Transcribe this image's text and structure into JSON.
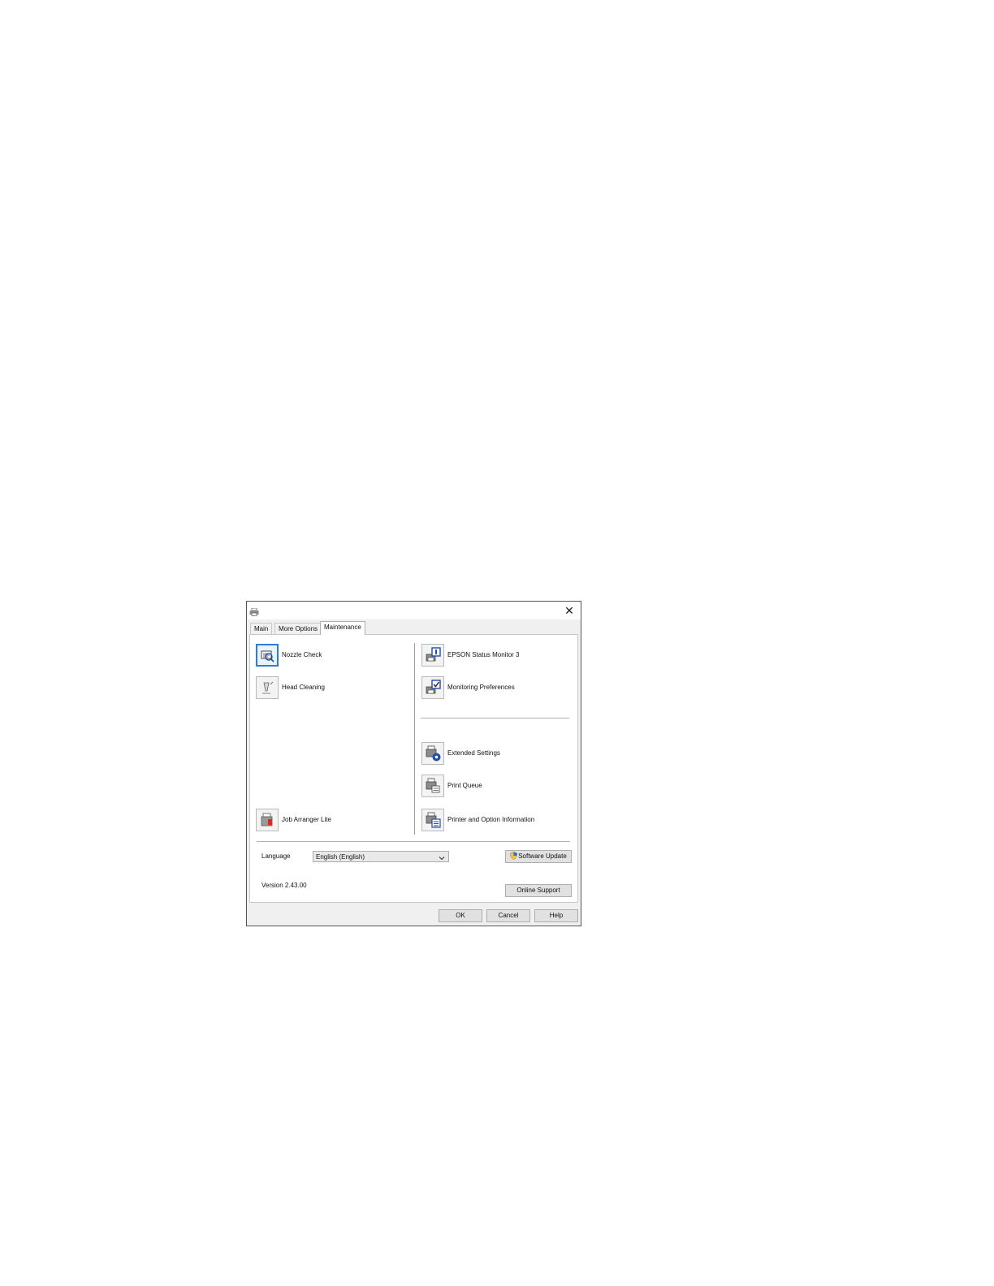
{
  "dialog": {
    "close_glyph": "✕",
    "app_icon": "printer-icon"
  },
  "tabs": [
    {
      "label": "Main"
    },
    {
      "label": "More Options"
    },
    {
      "label": "Maintenance",
      "active": true
    }
  ],
  "maintenance": {
    "left_items": [
      {
        "label": "Nozzle Check",
        "icon": "nozzle-check-icon",
        "selected": true
      },
      {
        "label": "Head Cleaning",
        "icon": "head-cleaning-icon"
      },
      {
        "label": "Job Arranger Lite",
        "icon": "job-arranger-icon"
      }
    ],
    "right_items": [
      {
        "label": "EPSON Status Monitor 3",
        "icon": "status-monitor-icon"
      },
      {
        "label": "Monitoring Preferences",
        "icon": "monitoring-preferences-icon"
      },
      {
        "label": "Extended Settings",
        "icon": "extended-settings-icon"
      },
      {
        "label": "Print Queue",
        "icon": "print-queue-icon"
      },
      {
        "label": "Printer and Option Information",
        "icon": "printer-info-icon"
      }
    ]
  },
  "language": {
    "label": "Language",
    "selected": "English (English)"
  },
  "software_update": {
    "label": "Software Update",
    "icon": "uac-shield-icon"
  },
  "online_support": {
    "label": "Online Support"
  },
  "version": "Version 2.43.00",
  "footer": {
    "ok": "OK",
    "cancel": "Cancel",
    "help": "Help"
  },
  "colors": {
    "selection": "#2a7fd4",
    "icon_blue": "#1f4fa8",
    "ink_red": "#d62a2a"
  }
}
